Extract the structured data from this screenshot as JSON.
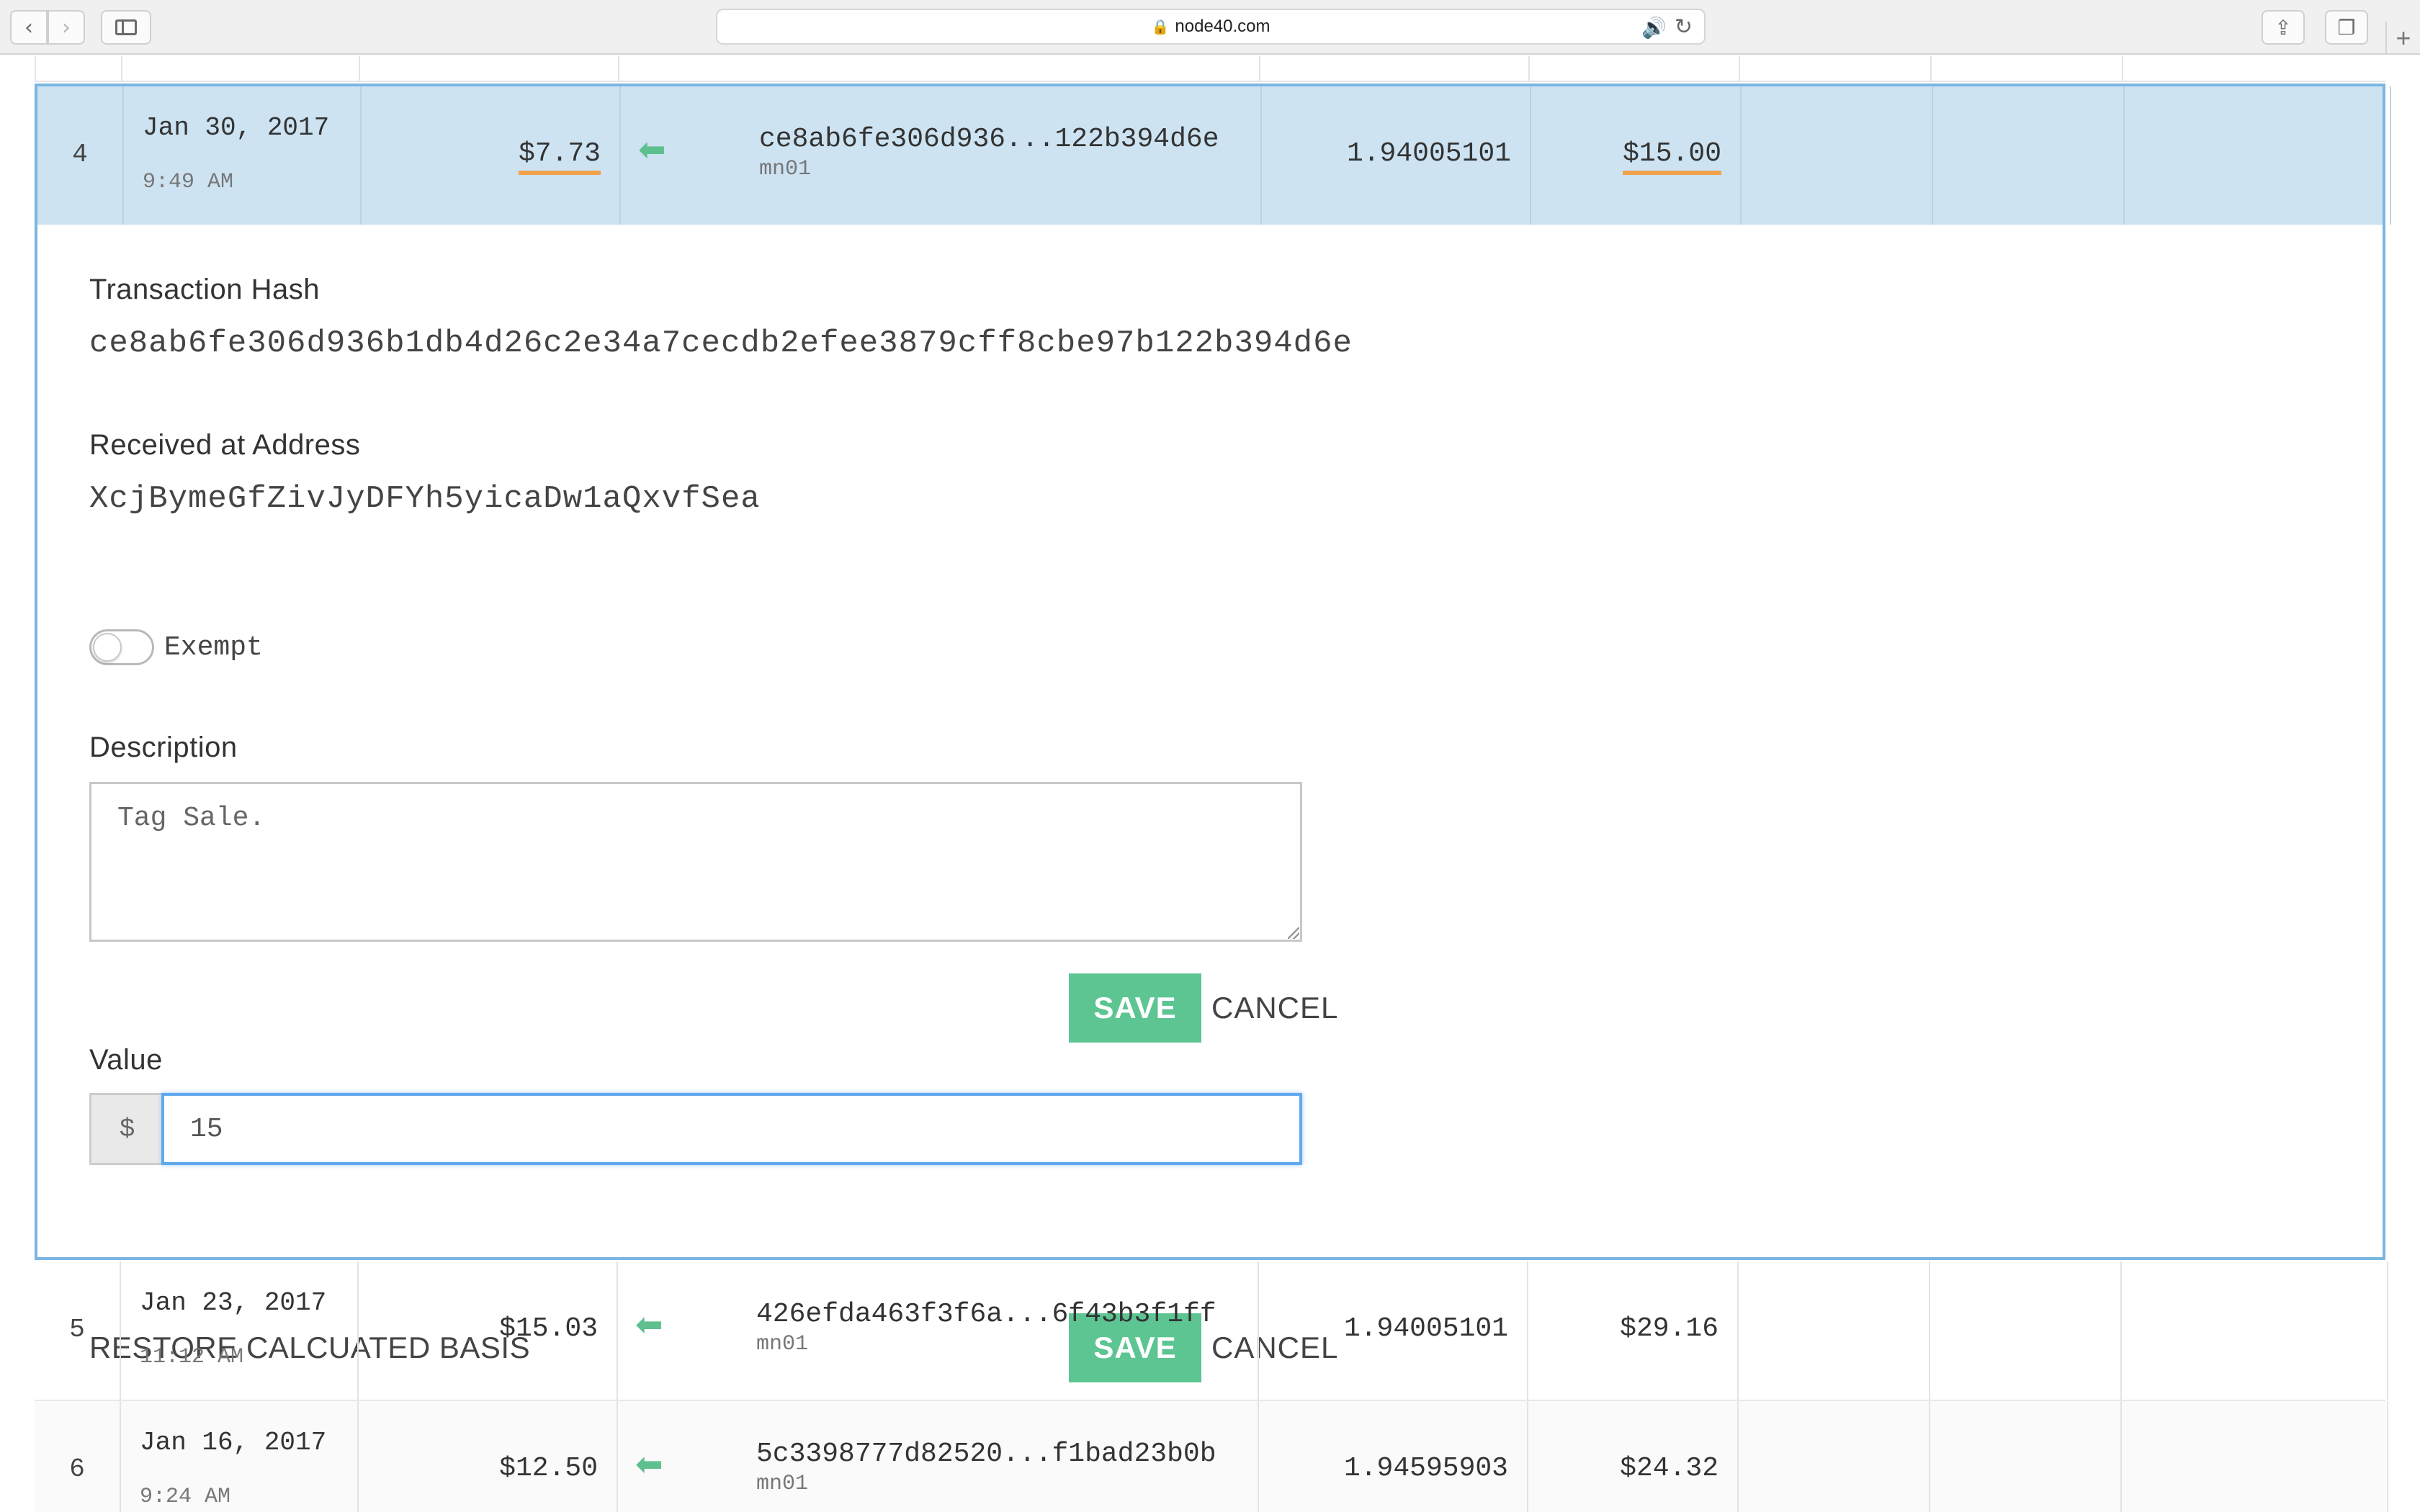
{
  "browser": {
    "url": "node40.com",
    "back_glyph": "‹",
    "forward_glyph": "›",
    "share_glyph": "⇪",
    "tabs_glyph": "❐",
    "newtab_glyph": "+",
    "lock_glyph": "🔒",
    "audio_glyph": "🔊",
    "reload_glyph": "↻"
  },
  "rows": [
    {
      "num": "4",
      "date": "Jan 30, 2017",
      "time": "9:49 AM",
      "basis": "$7.73",
      "direction_glyph": "⬅",
      "hash": "ce8ab6fe306d936...122b394d6e",
      "node": "mn01",
      "amount": "1.94005101",
      "value": "$15.00"
    },
    {
      "num": "5",
      "date": "Jan 23, 2017",
      "time": "11:12 AM",
      "basis": "$15.03",
      "direction_glyph": "⬅",
      "hash": "426efda463f3f6a...6f43b3f1ff",
      "node": "mn01",
      "amount": "1.94005101",
      "value": "$29.16"
    },
    {
      "num": "6",
      "date": "Jan 16, 2017",
      "time": "9:24 AM",
      "basis": "$12.50",
      "direction_glyph": "⬅",
      "hash": "5c3398777d82520...f1bad23b0b",
      "node": "mn01",
      "amount": "1.94595903",
      "value": "$24.32"
    }
  ],
  "detail": {
    "tx_hash_label": "Transaction Hash",
    "tx_hash": "ce8ab6fe306d936b1db4d26c2e34a7cecdb2efee3879cff8cbe97b122b394d6e",
    "address_label": "Received at Address",
    "address": "XcjBymeGfZivJyDFYh5yicaDw1aQxvfSea",
    "exempt_label": "Exempt",
    "description_label": "Description",
    "description_value": "Tag Sale.",
    "save_label": "SAVE",
    "cancel_label": "CANCEL",
    "value_label": "Value",
    "value_prefix": "$",
    "value_input": "15",
    "restore_label": "RESTORE CALCUATED BASIS"
  },
  "colors": {
    "selected_row_bg": "#cde3f2",
    "selected_border": "#7ab6e0",
    "save_button": "#5cc592",
    "incoming_arrow": "#5ec08f",
    "underline_accent": "#f0a24a",
    "input_focus": "#61a9ec"
  },
  "icons": {
    "incoming": "arrow-left-icon",
    "lock": "lock-icon",
    "audio": "speaker-icon",
    "reload": "reload-icon"
  }
}
